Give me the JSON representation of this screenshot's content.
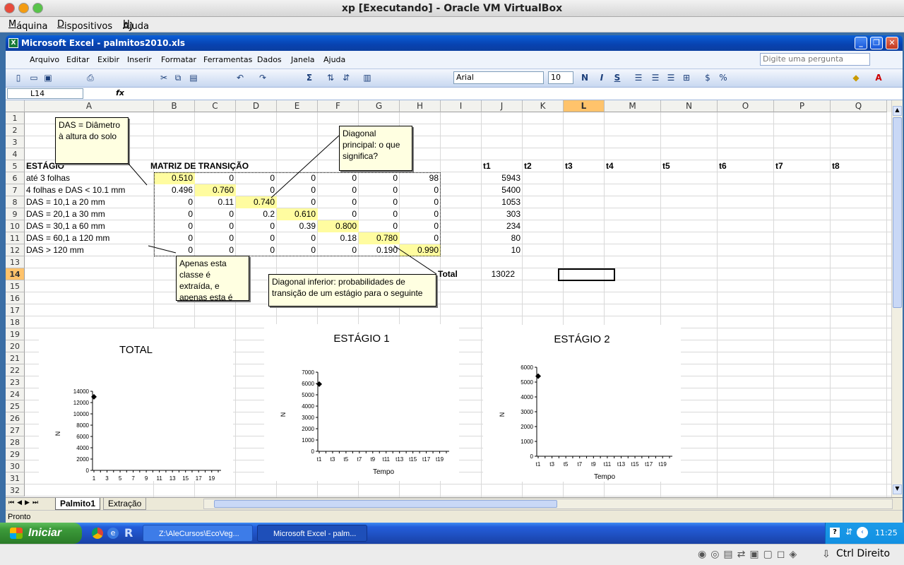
{
  "host": {
    "title": "xp [Executando] - Oracle VM VirtualBox",
    "menu": [
      {
        "pre": "",
        "u": "M",
        "post": "áquina"
      },
      {
        "pre": "",
        "u": "D",
        "post": "ispositivos"
      },
      {
        "pre": "Ajuda (",
        "u": "H",
        "post": ")"
      }
    ],
    "host_key": "Ctrl Direito"
  },
  "excel": {
    "title": "Microsoft Excel - palmitos2010.xls",
    "menu": [
      "Arquivo",
      "Editar",
      "Exibir",
      "Inserir",
      "Formatar",
      "Ferramentas",
      "Dados",
      "Janela",
      "Ajuda"
    ],
    "ask_placeholder": "Digite uma pergunta",
    "font": "Arial",
    "font_size": "10",
    "namebox": "L14",
    "fx": "fx",
    "columns": [
      "A",
      "B",
      "C",
      "D",
      "E",
      "F",
      "G",
      "H",
      "I",
      "J",
      "K",
      "L",
      "M",
      "N",
      "O",
      "P",
      "Q"
    ],
    "rows": [
      "1",
      "2",
      "3",
      "4",
      "5",
      "6",
      "7",
      "8",
      "9",
      "10",
      "11",
      "12",
      "13",
      "14",
      "15",
      "16",
      "17",
      "18",
      "19",
      "20",
      "21",
      "22",
      "23",
      "24",
      "25",
      "26",
      "27",
      "28",
      "29",
      "30",
      "31",
      "32"
    ],
    "labels": {
      "estagio": "ESTÁGIO",
      "matriz": "MATRIZ DE TRANSIÇÃO",
      "total": "Total",
      "total_value": "13022",
      "t_headers": [
        "t1",
        "t2",
        "t3",
        "t4",
        "t5",
        "t6",
        "t7",
        "t8"
      ]
    },
    "stages": [
      "até 3 folhas",
      "4 folhas e DAS < 10.1 mm",
      "DAS = 10,1 a 20 mm",
      "DAS = 20,1 a 30 mm",
      "DAS = 30,1 a 60 mm",
      "DAS = 60,1 a 120 mm",
      "DAS > 120 mm"
    ],
    "matrix": [
      [
        "0.510",
        "0",
        "0",
        "0",
        "0",
        "0",
        "98"
      ],
      [
        "0.496",
        "0.760",
        "0",
        "0",
        "0",
        "0",
        "0"
      ],
      [
        "0",
        "0.11",
        "0.740",
        "0",
        "0",
        "0",
        "0"
      ],
      [
        "0",
        "0",
        "0.2",
        "0.610",
        "0",
        "0",
        "0"
      ],
      [
        "0",
        "0",
        "0",
        "0.39",
        "0.800",
        "0",
        "0"
      ],
      [
        "0",
        "0",
        "0",
        "0",
        "0.18",
        "0.780",
        "0"
      ],
      [
        "0",
        "0",
        "0",
        "0",
        "0",
        "0.190",
        "0.990"
      ]
    ],
    "t1_values": [
      "5943",
      "5400",
      "1053",
      "303",
      "234",
      "80",
      "10"
    ],
    "notes": {
      "das": "DAS = Diâmetro à altura do solo",
      "diag_principal": "Diagonal principal: o que significa?",
      "extracao": "Apenas esta classe é extraída, e apenas esta é",
      "diag_inferior": "Diagonal inferior: probabilidades de transição de um estágio para o seguinte"
    },
    "sheet_tabs": [
      "Palmito1",
      "Extração"
    ],
    "status": "Pronto"
  },
  "chart_data": [
    {
      "type": "scatter",
      "title": "TOTAL",
      "xlabel": "Tempo",
      "ylabel": "N",
      "x_ticks": [
        "1",
        "3",
        "5",
        "7",
        "9",
        "11",
        "13",
        "15",
        "17",
        "19"
      ],
      "y_ticks": [
        "0",
        "2000",
        "4000",
        "6000",
        "8000",
        "10000",
        "12000",
        "14000"
      ],
      "ylim": [
        0,
        14000
      ],
      "points": [
        {
          "x": 1,
          "y": 13022
        }
      ]
    },
    {
      "type": "scatter",
      "title": "ESTÁGIO 1",
      "xlabel": "Tempo",
      "ylabel": "N",
      "x_ticks": [
        "t1",
        "t3",
        "t5",
        "t7",
        "t9",
        "t11",
        "t13",
        "t15",
        "t17",
        "t19"
      ],
      "y_ticks": [
        "0",
        "1000",
        "2000",
        "3000",
        "4000",
        "5000",
        "6000",
        "7000"
      ],
      "ylim": [
        0,
        7000
      ],
      "points": [
        {
          "x": 1,
          "y": 5943
        }
      ]
    },
    {
      "type": "scatter",
      "title": "ESTÁGIO 2",
      "xlabel": "Tempo",
      "ylabel": "N",
      "x_ticks": [
        "t1",
        "t3",
        "t5",
        "t7",
        "t9",
        "t11",
        "t13",
        "t15",
        "t17",
        "t19"
      ],
      "y_ticks": [
        "0",
        "1000",
        "2000",
        "3000",
        "4000",
        "5000",
        "6000"
      ],
      "ylim": [
        0,
        6000
      ],
      "points": [
        {
          "x": 1,
          "y": 5400
        }
      ]
    }
  ],
  "taskbar": {
    "start": "Iniciar",
    "tasks": [
      "Z:\\AleCursos\\EcoVeg...",
      "Microsoft Excel - palm..."
    ],
    "clock": "11:25"
  },
  "icons": [
    "excel-icon",
    "new-icon",
    "open-icon",
    "save-icon",
    "print-icon",
    "cut-icon",
    "copy-icon",
    "paste-icon",
    "undo-icon",
    "redo-icon",
    "sum-icon",
    "sort-asc-icon",
    "sort-desc-icon",
    "chart-icon",
    "bold-icon",
    "italic-icon",
    "underline-icon",
    "align-left-icon",
    "align-center-icon",
    "align-right-icon",
    "merge-icon",
    "currency-icon",
    "percent-icon",
    "fill-color-icon",
    "font-color-icon"
  ]
}
